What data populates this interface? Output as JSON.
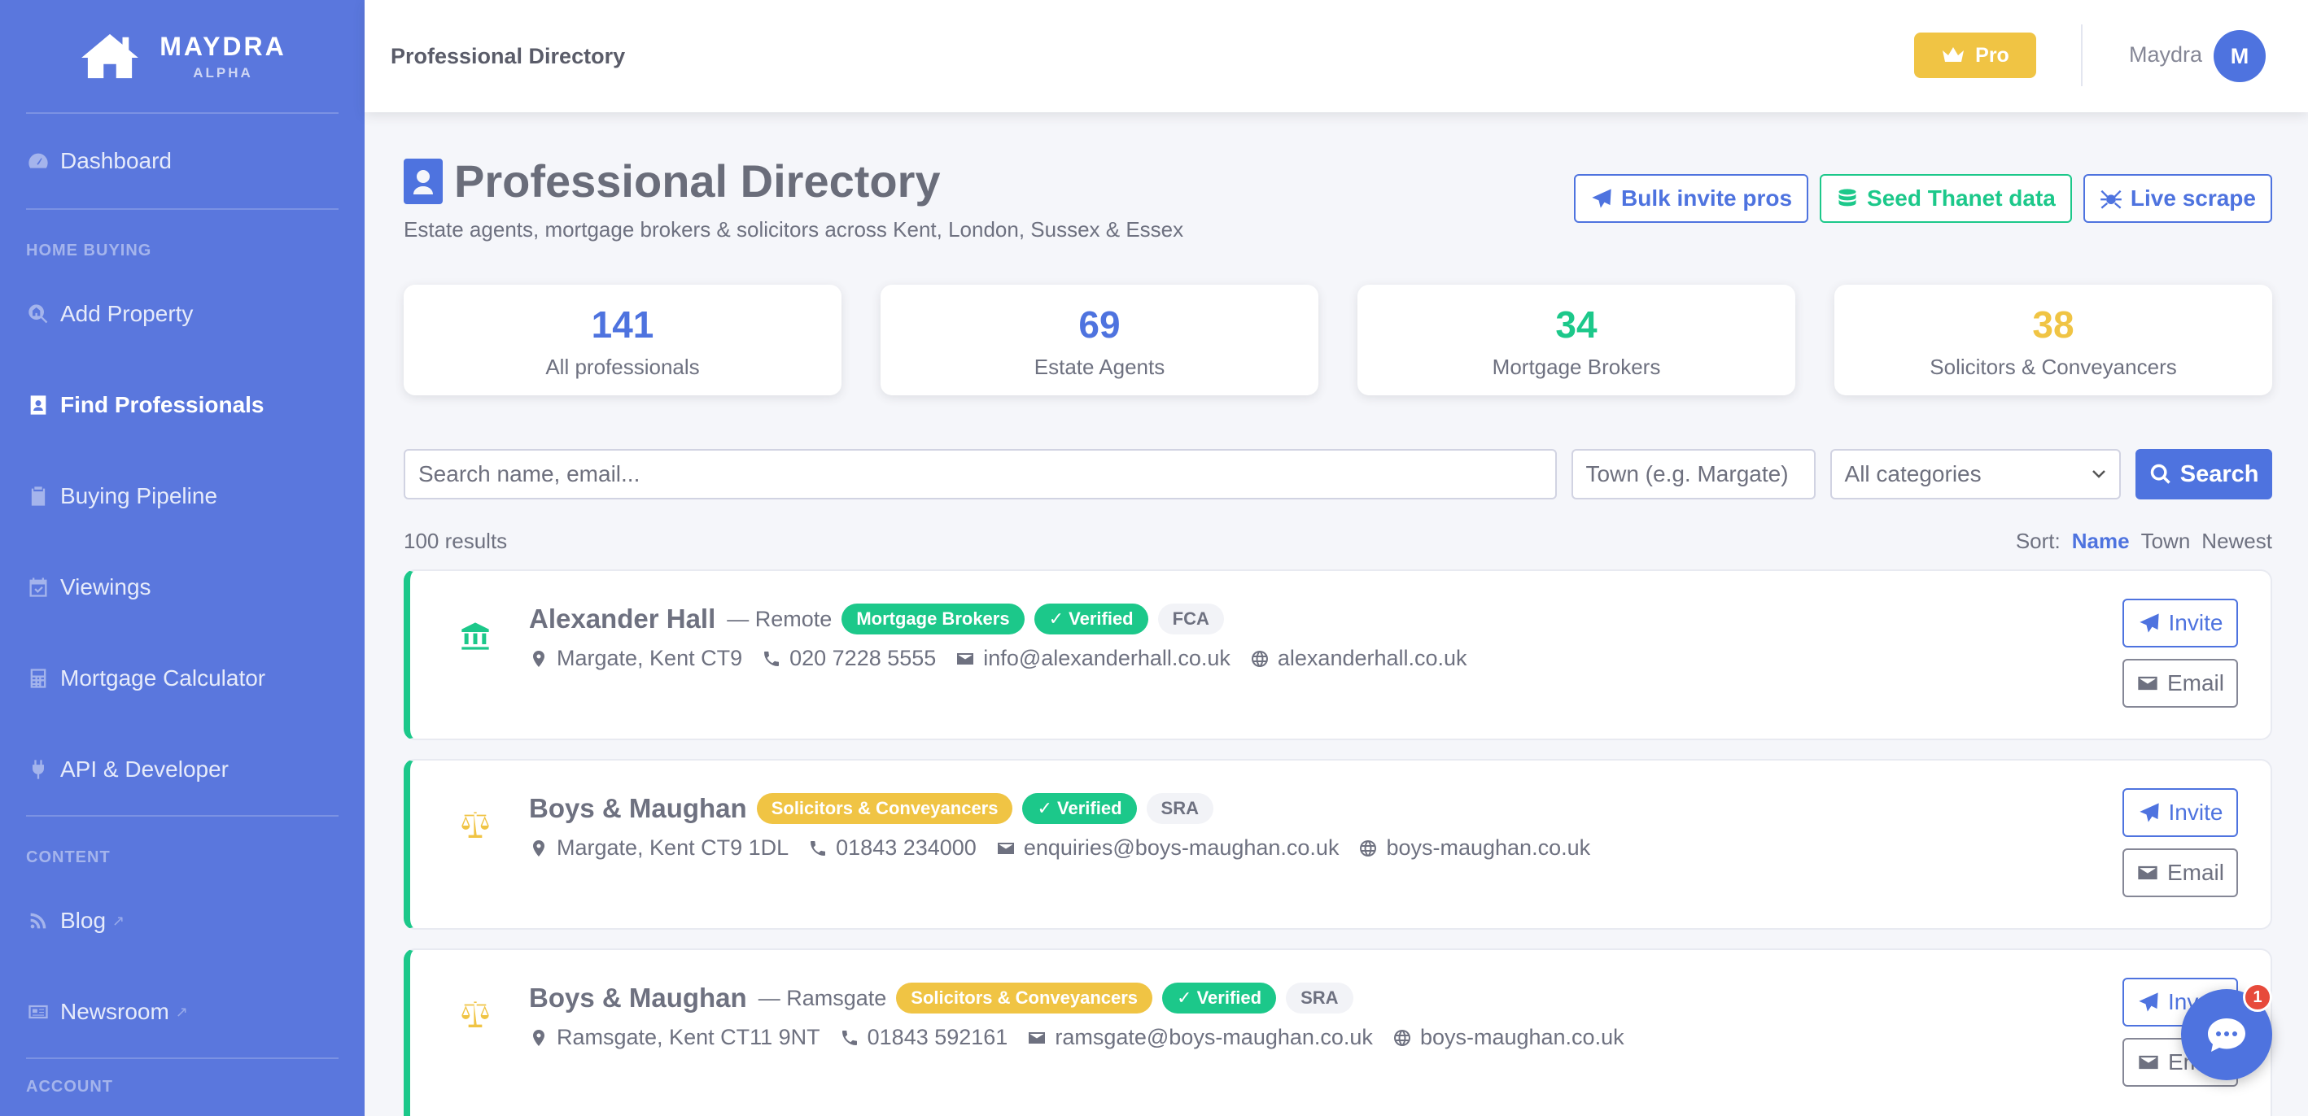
{
  "brand": {
    "name": "MAYDRA",
    "sub": "ALPHA"
  },
  "sidebar": {
    "items": [
      {
        "label": "Dashboard"
      },
      {
        "label": "Add Property"
      },
      {
        "label": "Find Professionals"
      },
      {
        "label": "Buying Pipeline"
      },
      {
        "label": "Viewings"
      },
      {
        "label": "Mortgage Calculator"
      },
      {
        "label": "API & Developer"
      },
      {
        "label": "Blog"
      },
      {
        "label": "Newsroom"
      }
    ],
    "sections": [
      "HOME BUYING",
      "CONTENT",
      "ACCOUNT"
    ]
  },
  "topbar": {
    "title": "Professional Directory",
    "pro_label": "Pro",
    "user_name": "Maydra",
    "avatar_initial": "M"
  },
  "page": {
    "title": "Professional Directory",
    "subtitle": "Estate agents, mortgage brokers & solicitors across Kent, London, Sussex & Essex",
    "buttons": {
      "bulk": "Bulk invite pros",
      "seed": "Seed Thanet data",
      "scrape": "Live scrape"
    }
  },
  "stats": [
    {
      "value": "141",
      "label": "All professionals",
      "color": "#4e73df"
    },
    {
      "value": "69",
      "label": "Estate Agents",
      "color": "#4e73df"
    },
    {
      "value": "34",
      "label": "Mortgage Brokers",
      "color": "#1cc88a"
    },
    {
      "value": "38",
      "label": "Solicitors & Conveyancers",
      "color": "#f0c444"
    }
  ],
  "search": {
    "placeholder": "Search name, email...",
    "town_placeholder": "Town (e.g. Margate)",
    "category": "All categories",
    "button": "Search"
  },
  "results": {
    "count": "100 results",
    "sort_label": "Sort:",
    "sort_options": [
      "Name",
      "Town",
      "Newest"
    ]
  },
  "cards": [
    {
      "name": "Alexander Hall",
      "loc": "— Remote",
      "category": "Mortgage Brokers",
      "verified": "✓ Verified",
      "reg": "FCA",
      "address": "Margate, Kent CT9",
      "phone": "020 7228 5555",
      "email": "info@alexanderhall.co.uk",
      "web": "alexanderhall.co.uk",
      "icon": "bank-icon"
    },
    {
      "name": "Boys & Maughan",
      "loc": "",
      "category": "Solicitors & Conveyancers",
      "verified": "✓ Verified",
      "reg": "SRA",
      "address": "Margate, Kent CT9 1DL",
      "phone": "01843 234000",
      "email": "enquiries@boys-maughan.co.uk",
      "web": "boys-maughan.co.uk",
      "icon": "scales-icon"
    },
    {
      "name": "Boys & Maughan",
      "loc": "— Ramsgate",
      "category": "Solicitors & Conveyancers",
      "verified": "✓ Verified",
      "reg": "SRA",
      "address": "Ramsgate, Kent CT11 9NT",
      "phone": "01843 592161",
      "email": "ramsgate@boys-maughan.co.uk",
      "web": "boys-maughan.co.uk",
      "icon": "scales-icon"
    }
  ],
  "card_actions": {
    "invite": "Invite",
    "email": "Email",
    "invite_partial": "Inv",
    "email_partial": "Em"
  },
  "chat": {
    "badge": "1"
  }
}
